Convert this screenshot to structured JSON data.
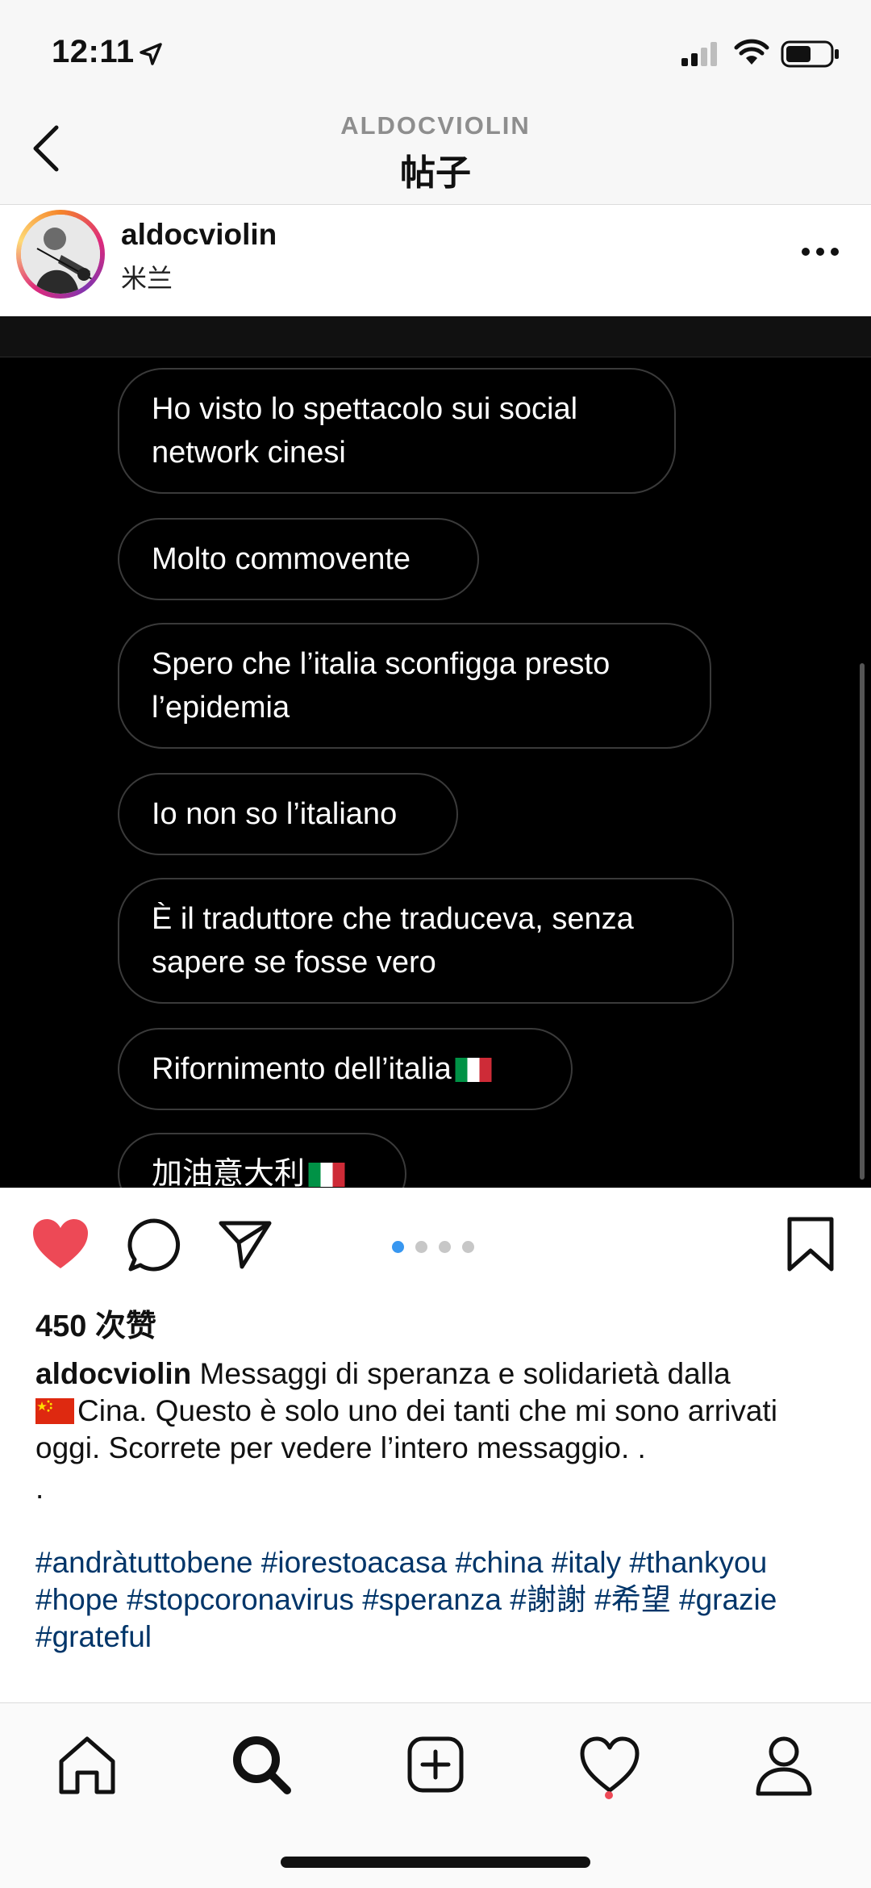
{
  "status_bar": {
    "time": "12:11"
  },
  "nav": {
    "subtitle": "ALDOCVIOLIN",
    "title": "帖子"
  },
  "post": {
    "username": "aldocviolin",
    "location": "米兰",
    "image_messages": [
      "Ho visto lo spettacolo sui social network cinesi",
      "Molto commovente",
      "Spero che l’italia sconfigga presto l’epidemia",
      "Io non so l’italiano",
      "È il traduttore che traduceva, senza sapere se fosse vero",
      "Rifornimento dell’italia",
      "加油意大利"
    ],
    "carousel": {
      "count": 4,
      "active": 1
    },
    "likes": "450 次赞",
    "caption": {
      "user": "aldocviolin",
      "text_1": "Messaggi di speranza e solidarietà dalla",
      "text_2": "Cina. Questo è solo uno dei tanti che mi sono arrivati oggi. Scorrete per vedere l’intero messaggio. .",
      "dot_line": ".",
      "hashtags": "#andràtuttobene #iorestoacasa #china #italy #thankyou #hope #stopcoronavirus #speranza #謝謝 #希望 #grazie #grateful"
    }
  },
  "colors": {
    "like": "#ed4956",
    "accent": "#3897f0",
    "hashtag": "#003569"
  },
  "icons": {
    "actions": [
      "heart-icon",
      "comment-icon",
      "share-icon",
      "bookmark-icon"
    ],
    "tabs": [
      "home-icon",
      "search-icon",
      "add-icon",
      "activity-icon",
      "profile-icon"
    ]
  }
}
